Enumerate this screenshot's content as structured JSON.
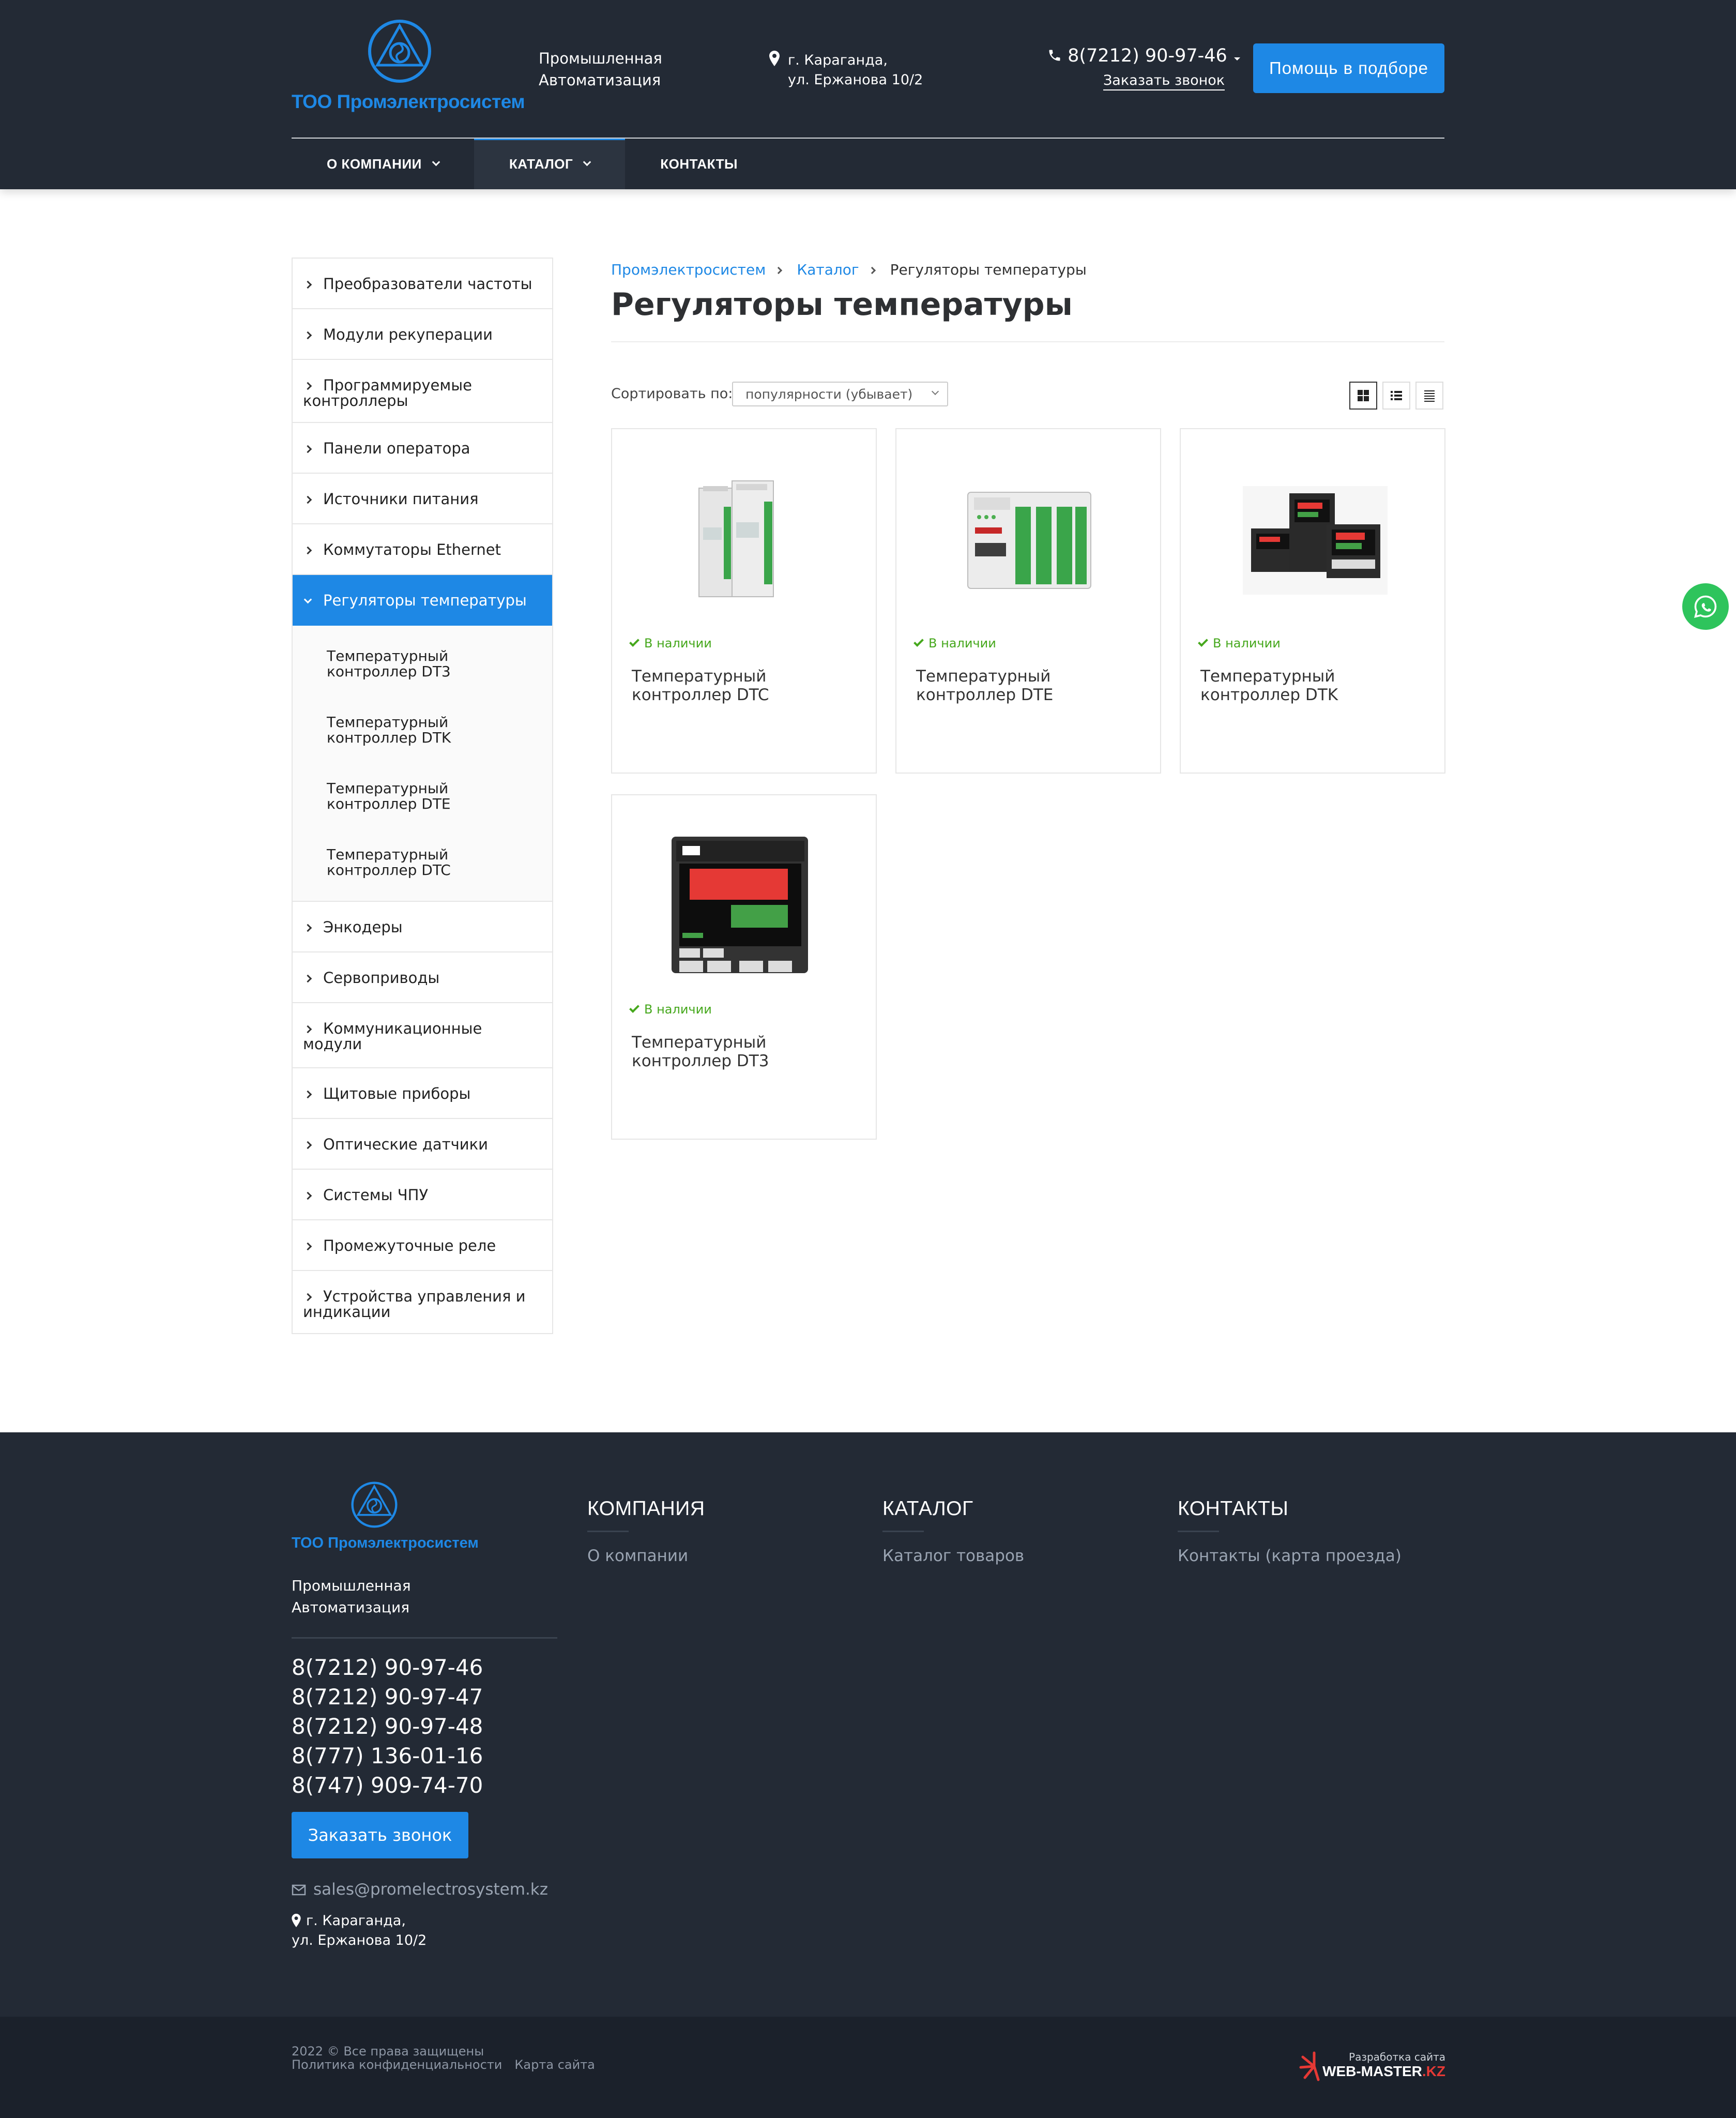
{
  "header": {
    "brand": "ТОО Промэлектросистем",
    "slogan_line1": "Промышленная",
    "slogan_line2": "Автоматизация",
    "address_line1": "г. Караганда,",
    "address_line2": "ул. Ержанова 10/2",
    "phone": "8(7212) 90-97-46",
    "callback": "Заказать звонок",
    "help_button": "Помощь в подборе"
  },
  "nav": [
    {
      "label": "О КОМПАНИИ"
    },
    {
      "label": "КАТАЛОГ"
    },
    {
      "label": "КОНТАКТЫ"
    }
  ],
  "sidebar": {
    "items": [
      {
        "label": "Преобразователи частоты"
      },
      {
        "label": "Модули рекуперации"
      },
      {
        "label": "Программируемые контроллеры"
      },
      {
        "label": "Панели оператора"
      },
      {
        "label": "Источники питания"
      },
      {
        "label": "Коммутаторы Ethernet"
      },
      {
        "label": "Регуляторы температуры"
      }
    ],
    "sub_items": [
      {
        "label": "Температурный контроллер DT3"
      },
      {
        "label": "Температурный контроллер DTK"
      },
      {
        "label": "Температурный контроллер DTE"
      },
      {
        "label": "Температурный контроллер DTC"
      }
    ],
    "items_after": [
      {
        "label": "Энкодеры"
      },
      {
        "label": "Сервоприводы"
      },
      {
        "label": "Коммуникационные модули"
      },
      {
        "label": "Щитовые приборы"
      },
      {
        "label": "Оптические датчики"
      },
      {
        "label": "Системы ЧПУ"
      },
      {
        "label": "Промежуточные реле"
      },
      {
        "label": "Устройства управления и индикации"
      }
    ]
  },
  "breadcrumb": [
    "Промэлектросистем",
    "Каталог",
    "Регуляторы температуры"
  ],
  "page_title": "Регуляторы температуры",
  "sort": {
    "label": "Сортировать по:",
    "value": "популярности (убывает)"
  },
  "products": [
    {
      "stock": "В наличии",
      "title": "Температурный контроллер DTC"
    },
    {
      "stock": "В наличии",
      "title": "Температурный контроллер DTE"
    },
    {
      "stock": "В наличии",
      "title": "Температурный контроллер DTK"
    },
    {
      "stock": "В наличии",
      "title": "Температурный контроллер DT3"
    }
  ],
  "footer": {
    "brand": "ТОО Промэлектросистем",
    "slogan_line1": "Промышленная",
    "slogan_line2": "Автоматизация",
    "phones": [
      "8(7212) 90-97-46",
      "8(7212) 90-97-47",
      "8(7212) 90-97-48",
      "8(777) 136-01-16",
      "8(747) 909-74-70"
    ],
    "callback": "Заказать звонок",
    "email": "sales@promelectrosystem.kz",
    "address_line1": "г. Караганда,",
    "address_line2": "ул. Ержанова 10/2",
    "columns": [
      {
        "title": "КОМПАНИЯ",
        "link": "О компании"
      },
      {
        "title": "КАТАЛОГ",
        "link": "Каталог товаров"
      },
      {
        "title": "КОНТАКТЫ",
        "link": "Контакты (карта проезда)"
      }
    ],
    "copyright": "2022 © Все права защищены",
    "privacy": "Политика конфиденциальности",
    "sitemap": "Карта сайта",
    "dev_label": "Разработка сайта",
    "dev_name": "WEB-MASTER",
    "dev_tld": ".KZ"
  },
  "colors": {
    "accent": "#1e88e5",
    "header_bg": "#232a35",
    "stock_green": "#46a81d",
    "whatsapp": "#2ec45c"
  }
}
